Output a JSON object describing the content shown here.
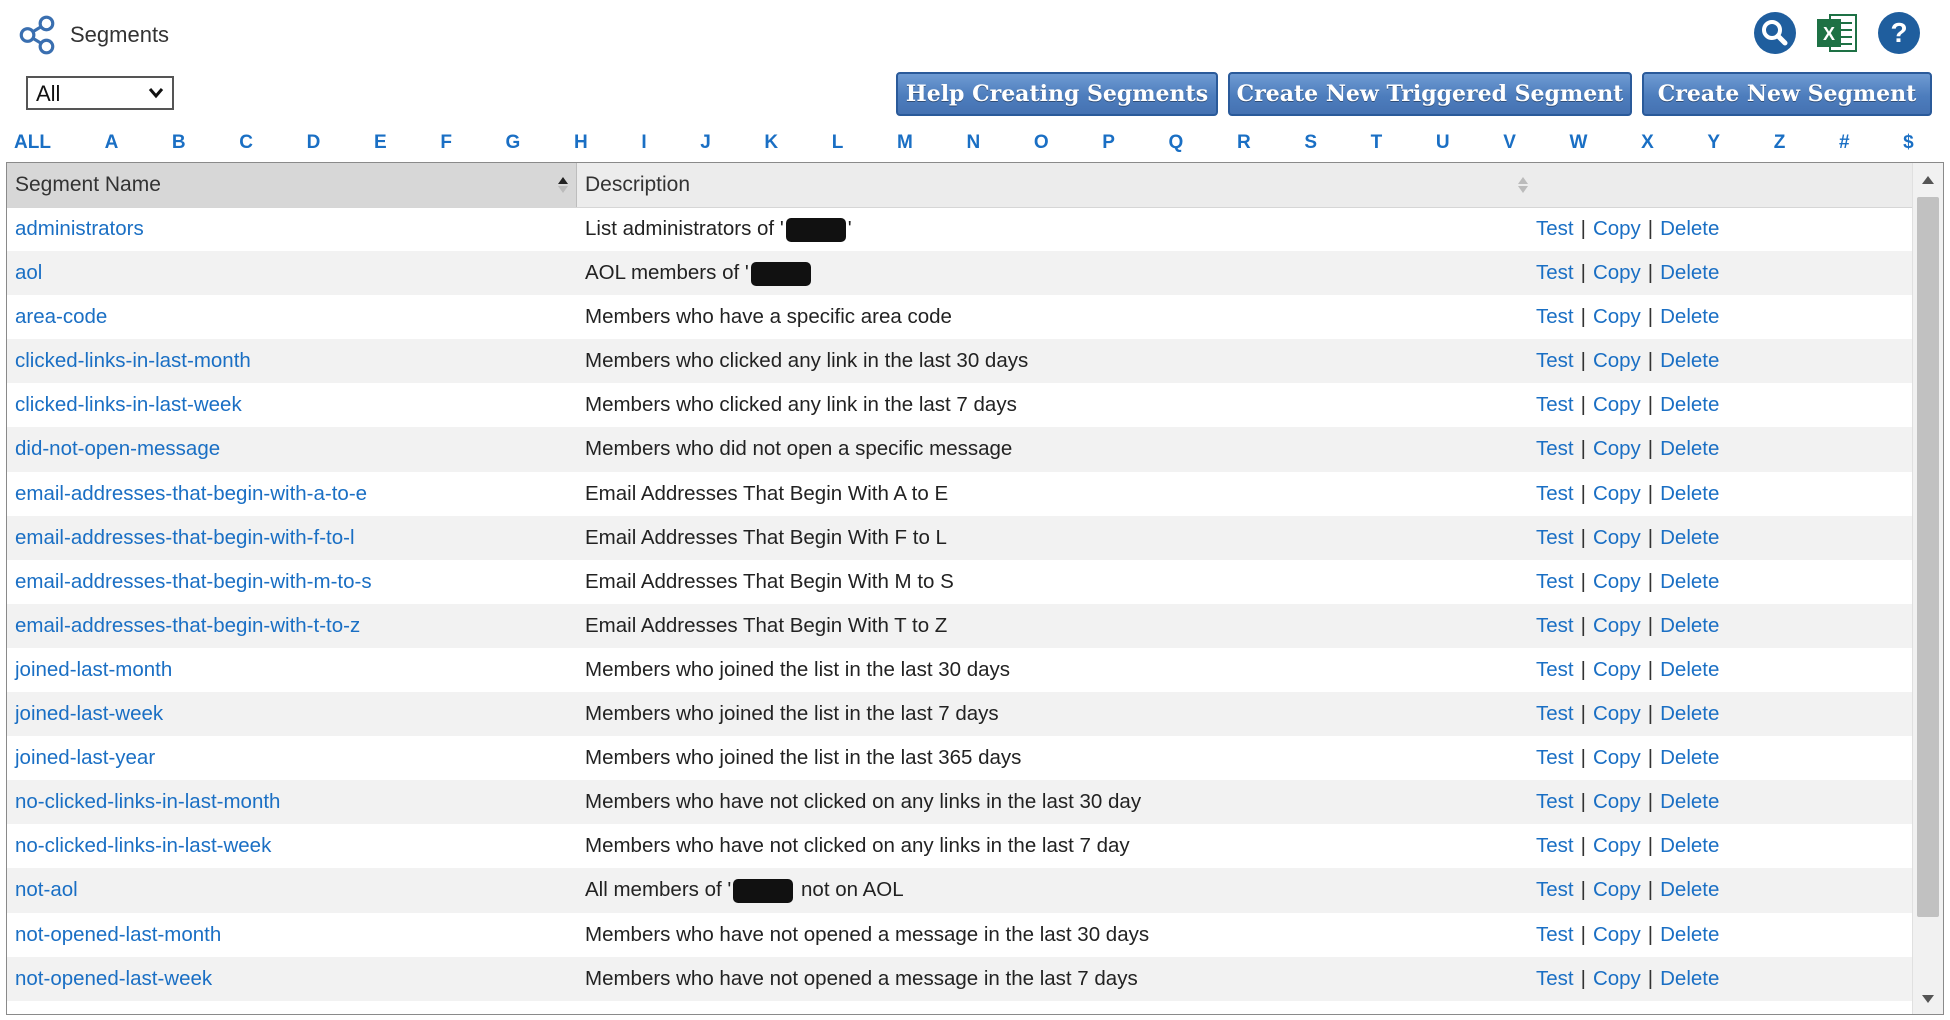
{
  "header": {
    "title": "Segments",
    "icons": [
      "share-icon",
      "search-icon",
      "excel-icon",
      "help-icon"
    ]
  },
  "filter": {
    "selected": "All"
  },
  "buttons": {
    "help": "Help Creating Segments",
    "triggered": "Create New Triggered Segment",
    "new": "Create New Segment"
  },
  "alphabet": [
    "ALL",
    "A",
    "B",
    "C",
    "D",
    "E",
    "F",
    "G",
    "H",
    "I",
    "J",
    "K",
    "L",
    "M",
    "N",
    "O",
    "P",
    "Q",
    "R",
    "S",
    "T",
    "U",
    "V",
    "W",
    "X",
    "Y",
    "Z",
    "#",
    "$"
  ],
  "table": {
    "columns": {
      "name": "Segment Name",
      "description": "Description"
    },
    "action_labels": {
      "test": "Test",
      "copy": "Copy",
      "delete": "Delete",
      "separator": "|"
    },
    "rows": [
      {
        "name": "administrators",
        "desc_before": "List administrators of '",
        "redacted": true,
        "desc_after": "'"
      },
      {
        "name": "aol",
        "desc_before": "AOL members of '",
        "redacted": true,
        "desc_after": ""
      },
      {
        "name": "area-code",
        "desc_before": "Members who have a specific area code",
        "redacted": false,
        "desc_after": ""
      },
      {
        "name": "clicked-links-in-last-month",
        "desc_before": "Members who clicked any link in the last 30 days",
        "redacted": false,
        "desc_after": ""
      },
      {
        "name": "clicked-links-in-last-week",
        "desc_before": "Members who clicked any link in the last 7 days",
        "redacted": false,
        "desc_after": ""
      },
      {
        "name": "did-not-open-message",
        "desc_before": "Members who did not open a specific message",
        "redacted": false,
        "desc_after": ""
      },
      {
        "name": "email-addresses-that-begin-with-a-to-e",
        "desc_before": "Email Addresses That Begin With A to E",
        "redacted": false,
        "desc_after": ""
      },
      {
        "name": "email-addresses-that-begin-with-f-to-l",
        "desc_before": "Email Addresses That Begin With F to L",
        "redacted": false,
        "desc_after": ""
      },
      {
        "name": "email-addresses-that-begin-with-m-to-s",
        "desc_before": "Email Addresses That Begin With M to S",
        "redacted": false,
        "desc_after": ""
      },
      {
        "name": "email-addresses-that-begin-with-t-to-z",
        "desc_before": "Email Addresses That Begin With T to Z",
        "redacted": false,
        "desc_after": ""
      },
      {
        "name": "joined-last-month",
        "desc_before": "Members who joined the list in the last 30 days",
        "redacted": false,
        "desc_after": ""
      },
      {
        "name": "joined-last-week",
        "desc_before": "Members who joined the list in the last 7 days",
        "redacted": false,
        "desc_after": ""
      },
      {
        "name": "joined-last-year",
        "desc_before": "Members who joined the list in the last 365 days",
        "redacted": false,
        "desc_after": ""
      },
      {
        "name": "no-clicked-links-in-last-month",
        "desc_before": "Members who have not clicked on any links in the last 30 day",
        "redacted": false,
        "desc_after": ""
      },
      {
        "name": "no-clicked-links-in-last-week",
        "desc_before": "Members who have not clicked on any links in the last 7 day",
        "redacted": false,
        "desc_after": ""
      },
      {
        "name": "not-aol",
        "desc_before": "All members of '",
        "redacted": true,
        "desc_after": " not on AOL"
      },
      {
        "name": "not-opened-last-month",
        "desc_before": "Members who have not opened a message in the last 30 days",
        "redacted": false,
        "desc_after": ""
      },
      {
        "name": "not-opened-last-week",
        "desc_before": "Members who have not opened a message in the last 7 days",
        "redacted": false,
        "desc_after": ""
      }
    ]
  },
  "colors": {
    "link": "#1a6fc4",
    "button": "#4d7dbd",
    "header_bg": "#ececec",
    "row_alt": "#f2f2f2"
  }
}
